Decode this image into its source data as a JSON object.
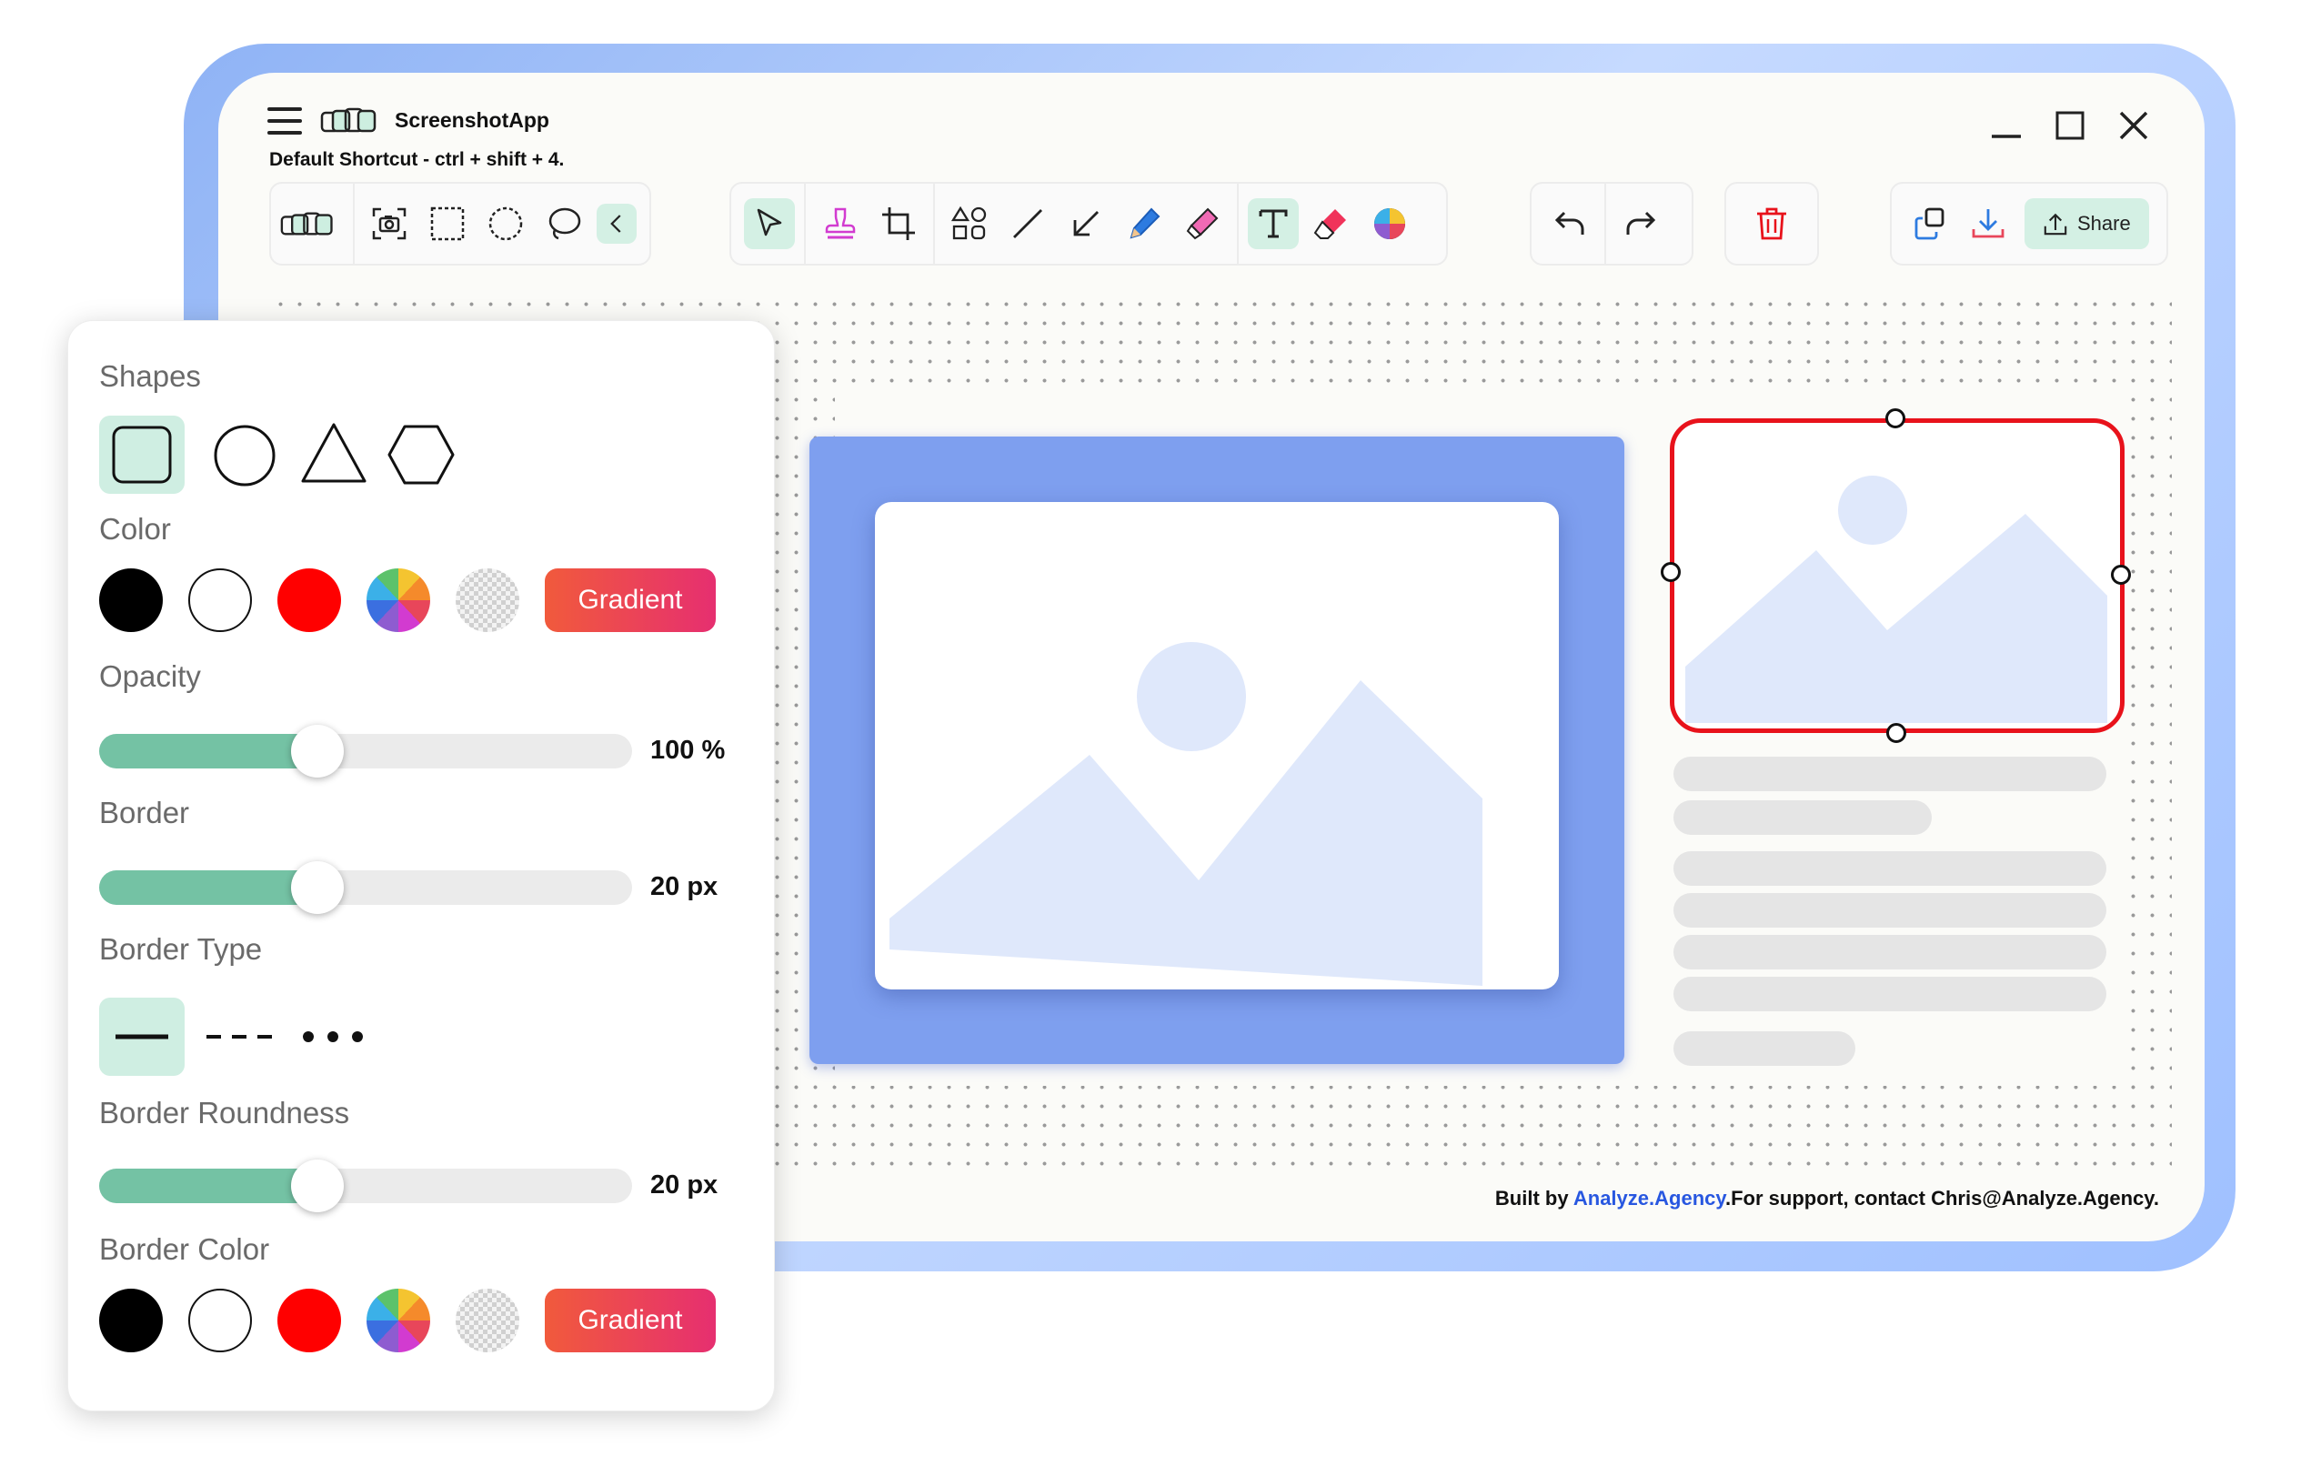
{
  "app": {
    "title": "ScreenshotApp",
    "shortcut": "Default Shortcut - ctrl + shift + 4."
  },
  "window_controls": [
    "minimize-icon",
    "maximize-icon",
    "close-icon"
  ],
  "toolbar": {
    "capture_group": [
      "logo-icon",
      "screenshot-camera-icon",
      "rectangle-select-icon",
      "circle-select-icon",
      "lasso-select-icon",
      "chevron-left-icon"
    ],
    "draw_group": [
      "pointer-icon",
      "stamp-icon",
      "crop-icon",
      "shapes-icon",
      "line-icon",
      "arrow-icon",
      "pen-icon",
      "highlighter-icon",
      "text-icon",
      "eraser-icon",
      "color-wheel-icon"
    ],
    "active_tools": [
      "pointer-icon",
      "text-icon"
    ],
    "history_group": [
      "undo-icon",
      "redo-icon"
    ],
    "delete_group": [
      "trash-icon"
    ],
    "export_group": [
      "copy-icon",
      "download-icon"
    ],
    "share_label": "Share"
  },
  "panel": {
    "shapes_label": "Shapes",
    "shapes": [
      "rounded-square-icon",
      "circle-icon",
      "triangle-icon",
      "hexagon-icon"
    ],
    "selected_shape": 0,
    "color_label": "Color",
    "colors": [
      "#000000",
      "#ffffff",
      "#ff0000",
      "rainbow",
      "transparent"
    ],
    "gradient_label": "Gradient",
    "opacity_label": "Opacity",
    "opacity_value": "100 %",
    "opacity_level": 0.41,
    "border_label": "Border",
    "border_value": "20 px",
    "border_level": 0.41,
    "border_type_label": "Border Type",
    "border_types": [
      "solid-line-icon",
      "dashed-line-icon",
      "dotted-line-icon"
    ],
    "selected_border_type": 0,
    "roundness_label": "Border Roundness",
    "roundness_value": "20 px",
    "roundness_level": 0.41,
    "border_color_label": "Border Color",
    "border_colors": [
      "#000000",
      "#ffffff",
      "#ff0000",
      "rainbow",
      "transparent"
    ],
    "border_gradient_label": "Gradient"
  },
  "footer": {
    "prefix": "Built by ",
    "link": "Analyze.Agency",
    "suffix": ".For support, contact Chris@Analyze.Agency."
  },
  "colors": {
    "accent": "#74c2a4",
    "accent_light": "#d4f0e4",
    "selection": "#e8121b",
    "frame": "#7e9fef"
  }
}
